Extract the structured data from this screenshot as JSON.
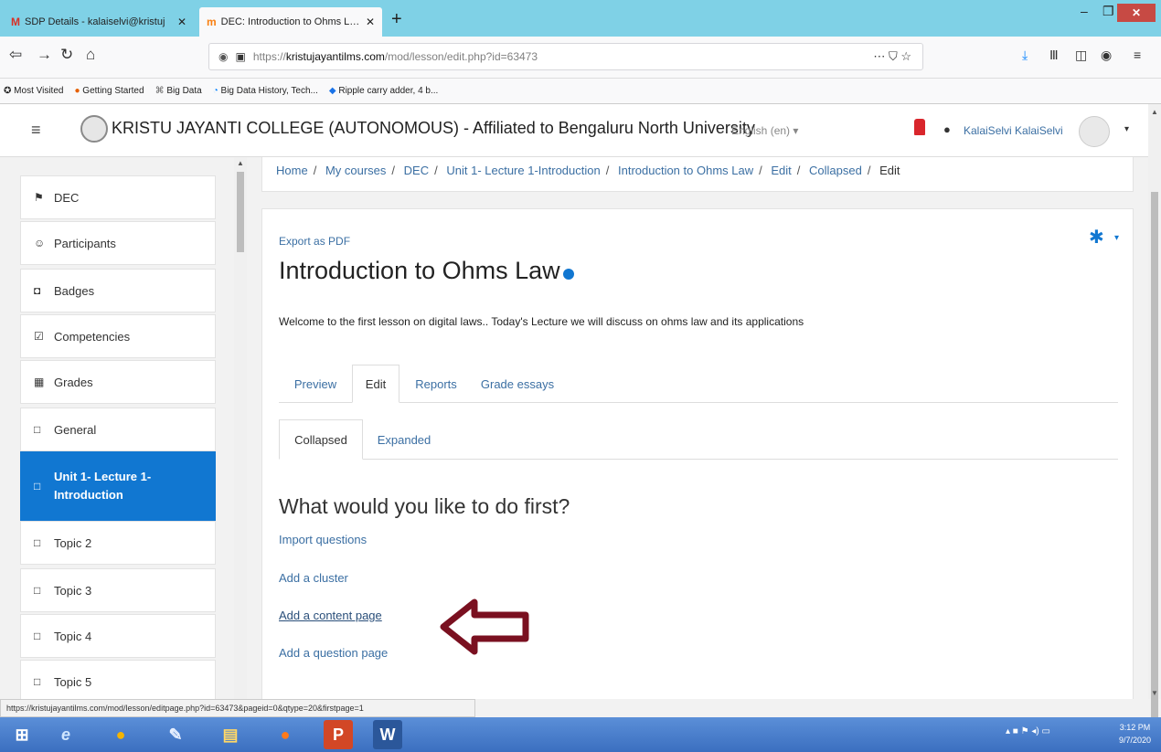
{
  "browser": {
    "tabs": [
      {
        "icon": "gmail-icon",
        "label": "SDP Details - kalaiselvi@kristuj",
        "active": false
      },
      {
        "icon": "moodle-icon",
        "label": "DEC: Introduction to Ohms Law",
        "active": true
      }
    ],
    "new_tab": "+",
    "url": {
      "scheme": "https://",
      "host": "kristujayantilms.com",
      "path": "/mod/lesson/edit.php?id=63473"
    },
    "url_actions": "⋯ ⛉ ☆",
    "bookmarks": [
      "Most Visited",
      "Getting Started",
      "Big Data",
      "Big Data History, Tech...",
      "Ripple carry adder, 4 b..."
    ],
    "status_url": "https://kristujayantilms.com/mod/lesson/editpage.php?id=63473&pageid=0&qtype=20&firstpage=1"
  },
  "header": {
    "site_title": "KRISTU JAYANTI COLLEGE (AUTONOMOUS) - Affiliated to Bengaluru North University",
    "language": "English (en) ▾",
    "username": "KalaiSelvi KalaiSelvi"
  },
  "sidebar": {
    "items": [
      {
        "label": "DEC",
        "icon": "graduation-cap-icon",
        "glyph": "⚑"
      },
      {
        "label": "Participants",
        "icon": "users-icon",
        "glyph": "☺"
      },
      {
        "label": "Badges",
        "icon": "shield-icon",
        "glyph": "◘"
      },
      {
        "label": "Competencies",
        "icon": "checkbox-icon",
        "glyph": "☑"
      },
      {
        "label": "Grades",
        "icon": "table-icon",
        "glyph": "▦"
      },
      {
        "label": "General",
        "icon": "folder-icon",
        "glyph": "□"
      },
      {
        "label": "Unit 1- Lecture 1-Introduction",
        "icon": "folder-icon",
        "glyph": "□",
        "active": true
      },
      {
        "label": "Topic 2",
        "icon": "folder-icon",
        "glyph": "□"
      },
      {
        "label": "Topic 3",
        "icon": "folder-icon",
        "glyph": "□"
      },
      {
        "label": "Topic 4",
        "icon": "folder-icon",
        "glyph": "□"
      },
      {
        "label": "Topic 5",
        "icon": "folder-icon",
        "glyph": "□"
      }
    ]
  },
  "breadcrumb": {
    "items": [
      "Home",
      "My courses",
      "DEC",
      "Unit 1- Lecture 1-Introduction",
      "Introduction to Ohms Law",
      "Edit",
      "Collapsed"
    ],
    "current": "Edit"
  },
  "lesson": {
    "export_label": "Export as PDF",
    "title": "Introduction to Ohms Law",
    "welcome": "Welcome to the first lesson on digital laws.. Today's Lecture we will discuss on ohms law and its applications",
    "tabs": [
      "Preview",
      "Edit",
      "Reports",
      "Grade essays"
    ],
    "selected_tab": "Edit",
    "subtabs": [
      "Collapsed",
      "Expanded"
    ],
    "selected_subtab": "Collapsed",
    "question": "What would you like to do first?",
    "actions": [
      "Import questions",
      "Add a cluster",
      "Add a content page",
      "Add a question page"
    ]
  },
  "taskbar": {
    "time": "3:12 PM",
    "date": "9/7/2020"
  },
  "colors": {
    "accent": "#1177d1",
    "link": "#3b6fa3",
    "arrow": "#7a1020",
    "tab_bar": "#7fd1e6"
  }
}
